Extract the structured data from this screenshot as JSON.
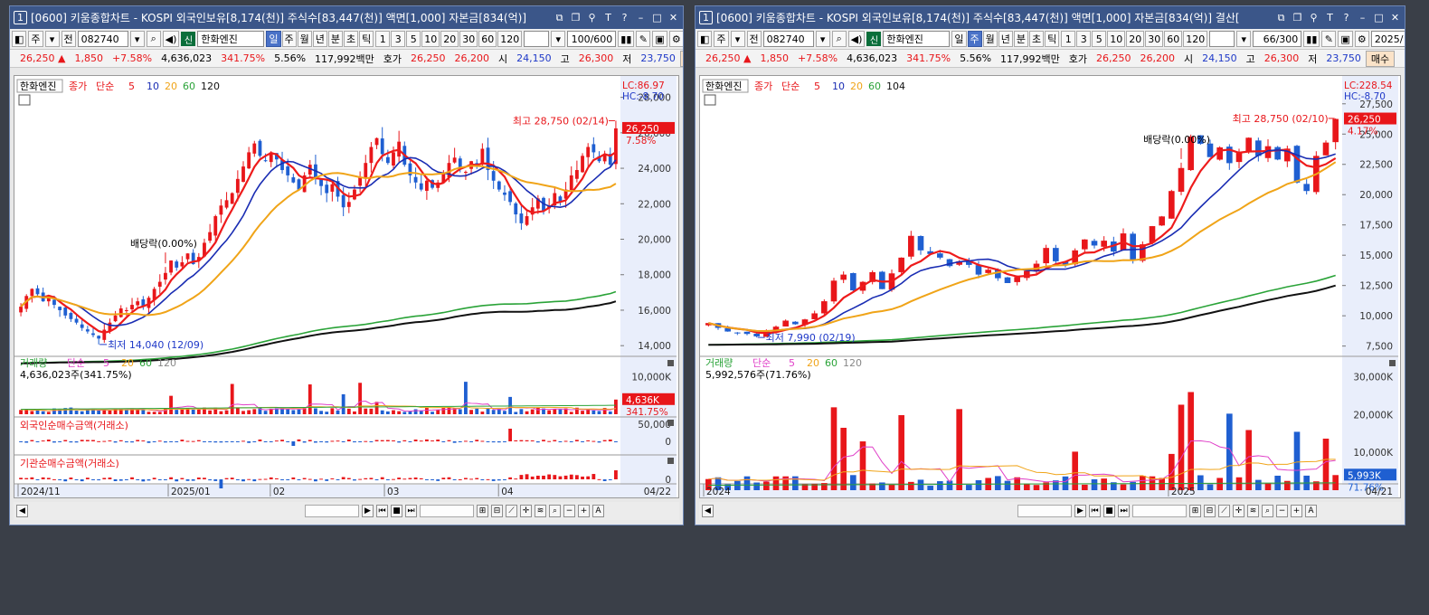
{
  "windows": [
    {
      "title_num": "1",
      "title": "[0600] 키움종합차트 - KOSPI 외국인보유[8,174(천)] 주식수[83,447(천)] 액면[1,000] 자본금[834(억)]",
      "toolbar": {
        "period_sel": "주",
        "period_all": "전",
        "code": "082740",
        "shin": "신",
        "name": "한화엔진",
        "intervals": [
          "일",
          "주",
          "월",
          "년",
          "분",
          "초",
          "틱"
        ],
        "active_interval": "일",
        "nums": [
          "1",
          "3",
          "5",
          "10",
          "20",
          "30",
          "60",
          "120"
        ],
        "count": "100/600",
        "date": ""
      },
      "quote": {
        "price": "26,250",
        "arrow": "▲",
        "change": "1,850",
        "rate": "+7.58%",
        "volume": "4,636,023",
        "vol_ratio": "341.75%",
        "turnover": "5.56%",
        "amount": "117,992백만",
        "hoga_label": "호가",
        "ask": "26,250",
        "bid": "26,200",
        "open_label": "시",
        "open": "24,150",
        "high_label": "고",
        "high": "26,300",
        "low_label": "저",
        "low": "23,750",
        "extra": "매"
      },
      "chart_data": {
        "type": "candlestick",
        "legend": {
          "name": "한화엔진",
          "close": "종가",
          "method": "단순",
          "ma": [
            "5",
            "10",
            "20",
            "60",
            "120"
          ]
        },
        "ylim": [
          13500,
          29000
        ],
        "yticks": [
          "28,000",
          "26,000",
          "24,000",
          "22,000",
          "20,000",
          "18,000",
          "16,000",
          "14,000"
        ],
        "ytick_values": [
          28000,
          26000,
          24000,
          22000,
          20000,
          18000,
          16000,
          14000
        ],
        "lc": "LC:86.97",
        "hc": "HC:-8.70",
        "last_price": "26,250",
        "last_rate": "7.58%",
        "high_note": "최고 28,750 (02/14)",
        "low_note": "최저 14,040 (12/09)",
        "div_note": "배당락(0.00%)",
        "closes": [
          16200,
          16800,
          17200,
          16900,
          16500,
          16700,
          16300,
          16000,
          15700,
          15500,
          15300,
          15000,
          14800,
          14600,
          14400,
          14900,
          15300,
          15700,
          16100,
          16000,
          16300,
          16500,
          16200,
          16700,
          17200,
          17600,
          18100,
          18800,
          18400,
          18700,
          19200,
          18600,
          19000,
          19800,
          20400,
          21300,
          21900,
          22200,
          22600,
          23400,
          24100,
          24900,
          25400,
          24700,
          24400,
          24900,
          24500,
          23900,
          23600,
          23200,
          22800,
          23600,
          24200,
          23400,
          23000,
          22600,
          23100,
          22400,
          21800,
          22100,
          22800,
          23500,
          24300,
          25200,
          25700,
          24800,
          24300,
          24900,
          25500,
          24200,
          23600,
          23200,
          22800,
          23300,
          22900,
          23200,
          23700,
          24300,
          24600,
          24000,
          23800,
          24400,
          24100,
          25100,
          23900,
          23300,
          22800,
          22500,
          22100,
          21400,
          20900,
          21300,
          21800,
          22300,
          21600,
          21900,
          22600,
          22100,
          22800,
          23600,
          23900,
          24700,
          25200,
          24900,
          24400,
          24800,
          24200,
          26250
        ],
        "ma5": [],
        "ma20": [],
        "ma60": [],
        "ma120": [],
        "volume": {
          "title": "거래량",
          "method": "단순",
          "ma": [
            "5",
            "20",
            "60",
            "120"
          ],
          "value": "4,636,023주(341.75%)",
          "ticks": [
            "10,000K"
          ],
          "last": "4,636K",
          "last_rate": "341.75%"
        },
        "foreign": {
          "title": "외국인순매수금액(거래소)",
          "ticks": [
            "50,000",
            "0"
          ]
        },
        "inst": {
          "title": "기관순매수금액(거래소)",
          "ticks": [
            "0"
          ]
        },
        "xlabels": [
          "2024/11",
          "2025/01",
          "02",
          "03",
          "04"
        ],
        "xlabel_pos": [
          0,
          0.25,
          0.42,
          0.61,
          0.8
        ],
        "last_date": "04/22"
      },
      "colors": {
        "up": "#e8161a",
        "down": "#1f5fd1",
        "ma5": "#ee1b1b",
        "ma10": "#1a2db3",
        "ma20": "#f0a418",
        "ma60": "#2aa338",
        "ma120": "#111111"
      }
    },
    {
      "title_num": "1",
      "title": "[0600] 키움종합차트 - KOSPI 외국인보유[8,174(천)] 주식수[83,447(천)] 액면[1,000] 자본금[834(억)] 결산[",
      "toolbar": {
        "period_sel": "주",
        "period_all": "전",
        "code": "082740",
        "shin": "신",
        "name": "한화엔진",
        "intervals": [
          "일",
          "주",
          "월",
          "년",
          "분",
          "초",
          "틱"
        ],
        "active_interval": "주",
        "nums": [
          "1",
          "3",
          "5",
          "10",
          "20",
          "30",
          "60",
          "120"
        ],
        "count": "66/300",
        "date": "2025/"
      },
      "quote": {
        "price": "26,250",
        "arrow": "▲",
        "change": "1,850",
        "rate": "+7.58%",
        "volume": "4,636,023",
        "vol_ratio": "341.75%",
        "turnover": "5.56%",
        "amount": "117,992백만",
        "hoga_label": "호가",
        "ask": "26,250",
        "bid": "26,200",
        "open_label": "시",
        "open": "24,150",
        "high_label": "고",
        "high": "26,300",
        "low_label": "저",
        "low": "23,750",
        "extra": "매수"
      },
      "chart_data": {
        "type": "candlestick",
        "legend": {
          "name": "한화엔진",
          "close": "종가",
          "method": "단순",
          "ma": [
            "5",
            "10",
            "20",
            "60",
            "104"
          ]
        },
        "ylim": [
          6800,
          29500
        ],
        "yticks": [
          "27,500",
          "25,000",
          "22,500",
          "20,000",
          "17,500",
          "15,000",
          "12,500",
          "10,000",
          "7,500"
        ],
        "ytick_values": [
          27500,
          25000,
          22500,
          20000,
          17500,
          15000,
          12500,
          10000,
          7500
        ],
        "lc": "LC:228.54",
        "hc": "HC:-8.70",
        "last_price": "26,250",
        "last_rate": "4.17%",
        "high_note": "최고 28,750 (02/10)",
        "low_note": "최저 7,990 (02/19)",
        "div_note": "배당락(0.00%)",
        "closes": [
          9400,
          9000,
          8700,
          8600,
          8500,
          8300,
          8700,
          9100,
          9600,
          9300,
          9700,
          10200,
          11200,
          12900,
          13400,
          12100,
          12800,
          13600,
          12200,
          13500,
          14800,
          16600,
          15400,
          15100,
          14800,
          14100,
          14500,
          14200,
          13400,
          13800,
          13100,
          12700,
          13200,
          13700,
          14300,
          15600,
          14500,
          14200,
          15400,
          16300,
          15800,
          16200,
          15300,
          16800,
          14600,
          15900,
          17400,
          18200,
          20300,
          22200,
          24800,
          24200,
          23100,
          23900,
          22600,
          23500,
          24700,
          23200,
          24000,
          22900,
          23800,
          21000,
          20300,
          23200,
          24300,
          26250
        ],
        "volume": {
          "title": "거래량",
          "method": "단순",
          "ma": [
            "5",
            "20",
            "60",
            "120"
          ],
          "value": "5,992,576주(71.76%)",
          "ticks": [
            "30,000K",
            "20,000K",
            "10,000K"
          ],
          "last": "5,993K",
          "last_rate": "71.76%"
        },
        "xlabels": [
          "2024",
          "2025"
        ],
        "xlabel_pos": [
          0,
          0.73
        ],
        "last_date": "04/21"
      },
      "colors": {
        "up": "#e8161a",
        "down": "#1f5fd1",
        "ma5": "#ee1b1b",
        "ma10": "#1a2db3",
        "ma20": "#f0a418",
        "ma60": "#2aa338",
        "ma120": "#111111"
      }
    }
  ],
  "scroll": {
    "zoom_icons": [
      "search-icon",
      "minus",
      "plus",
      "A"
    ]
  }
}
